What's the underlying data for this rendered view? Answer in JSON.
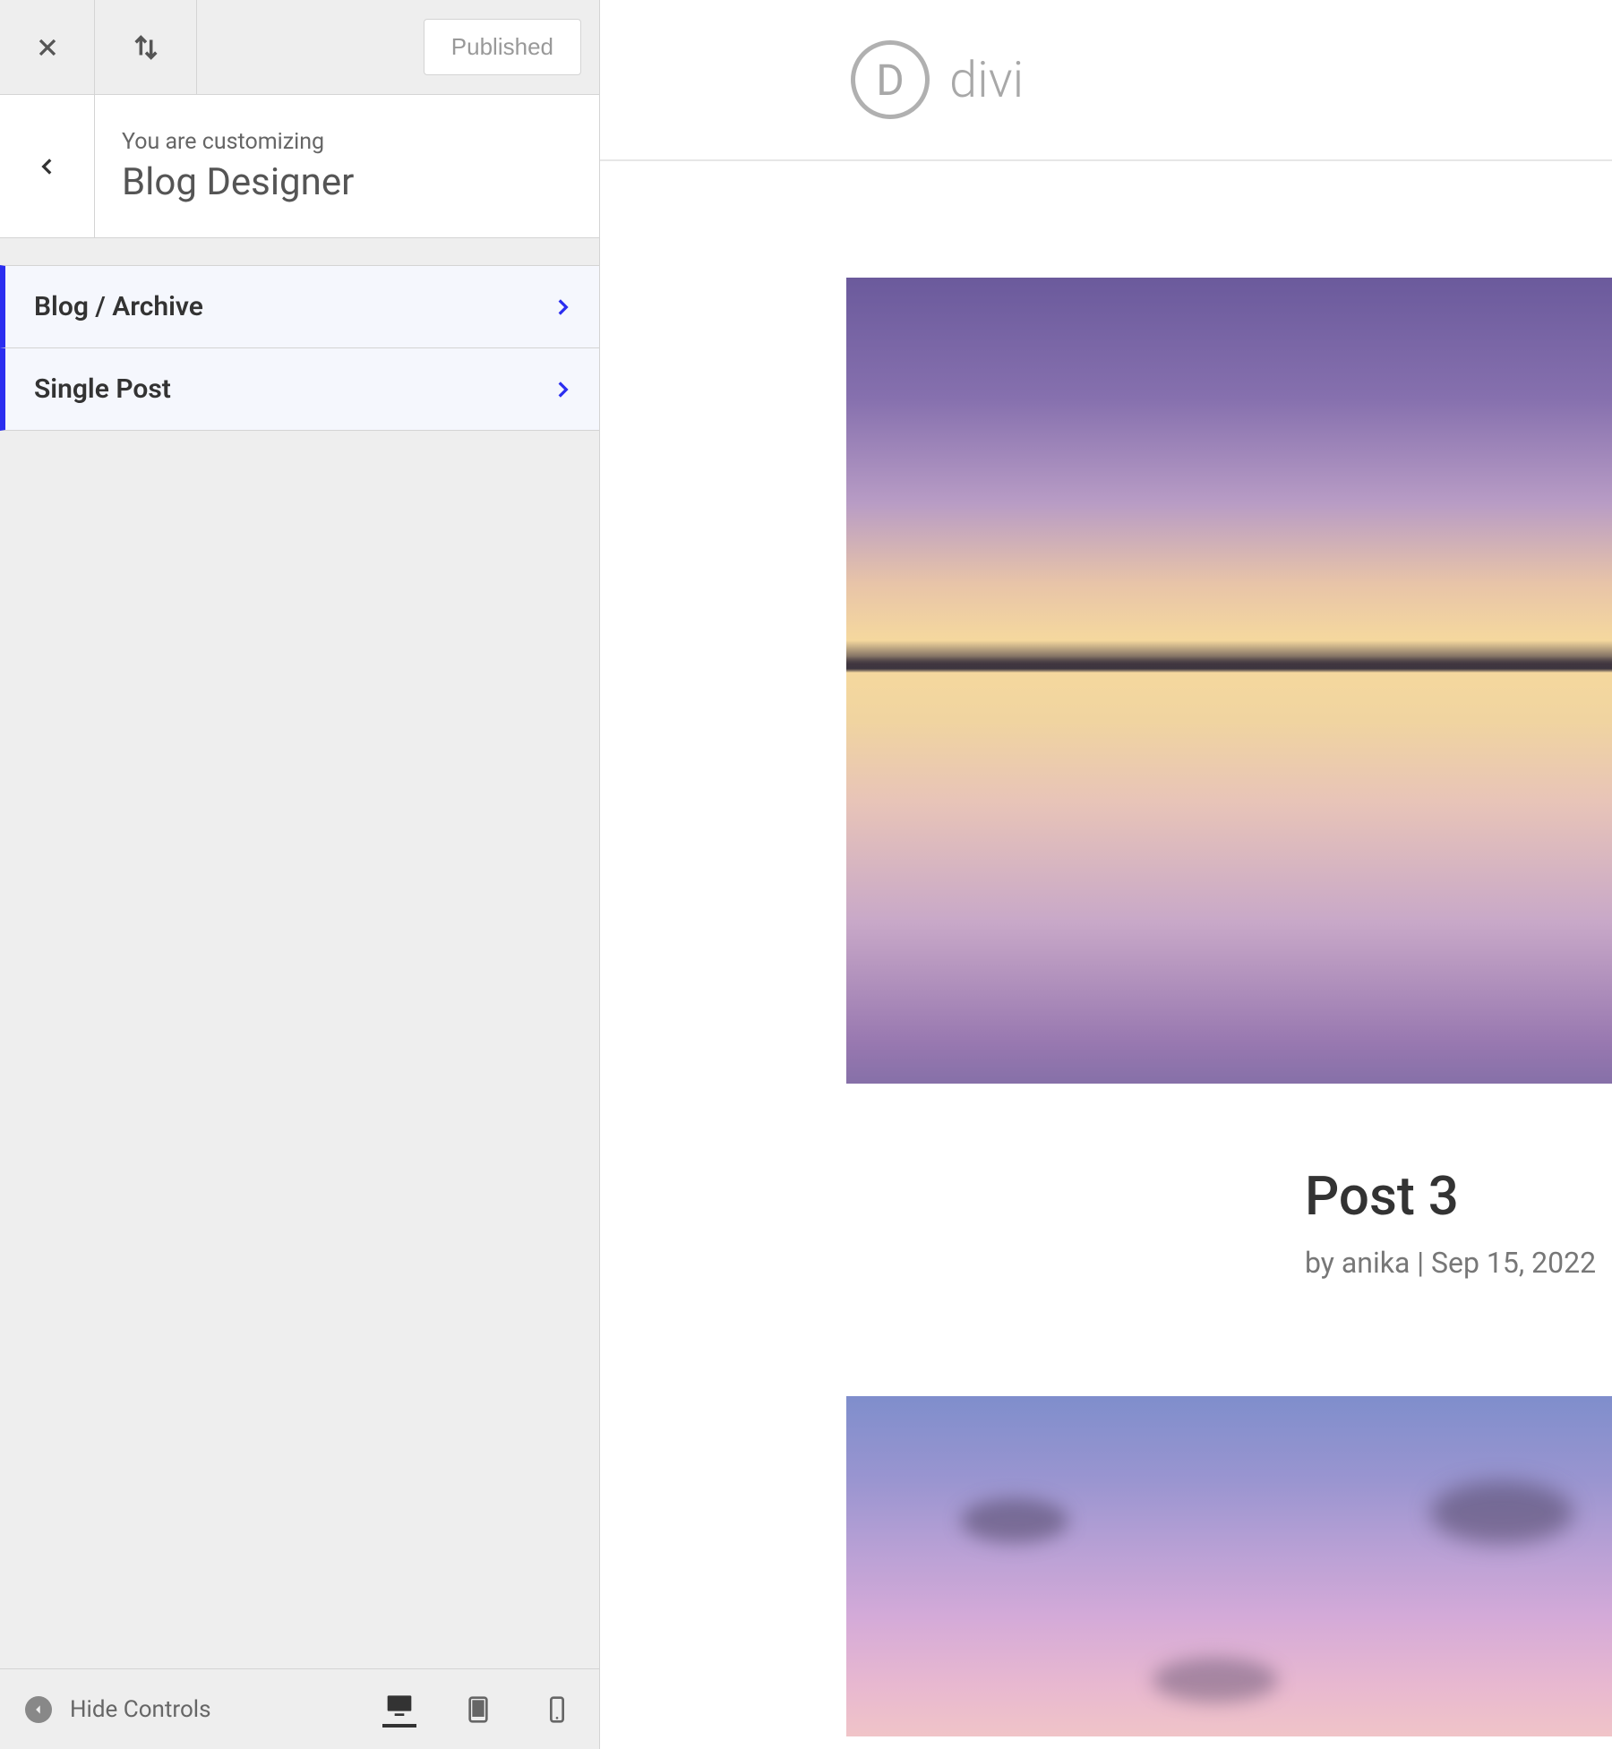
{
  "sidebar": {
    "publish_button": "Published",
    "customizing_label": "You are customizing",
    "panel_title": "Blog Designer",
    "nav_items": [
      {
        "label": "Blog / Archive"
      },
      {
        "label": "Single Post"
      }
    ],
    "hide_controls": "Hide Controls"
  },
  "preview": {
    "logo_letter": "D",
    "logo_text": "divi",
    "post": {
      "title": "Post 3",
      "meta_by": "by",
      "meta_author": "anika",
      "meta_sep": " | ",
      "meta_date": "Sep 15, 2022"
    }
  }
}
